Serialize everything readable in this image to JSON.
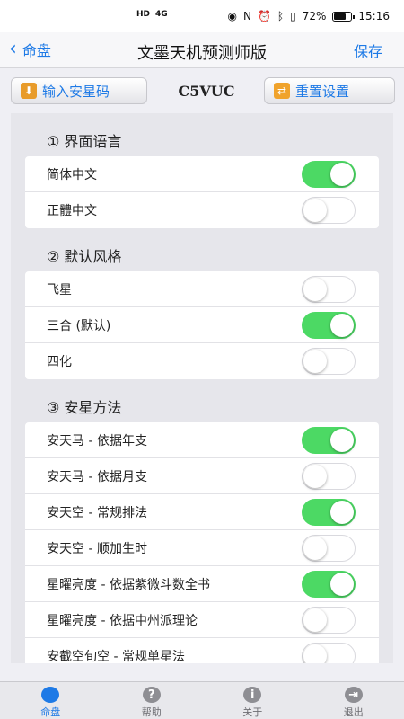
{
  "status": {
    "time": "15:16",
    "battery": "72%",
    "network": "4G"
  },
  "nav": {
    "back_label": "命盘",
    "title": "文墨天机预测师版",
    "save_label": "保存"
  },
  "toolbar": {
    "import_label": "输入安星码",
    "code": "C5VUC",
    "reset_label": "重置设置"
  },
  "sections": [
    {
      "title": "① 界面语言",
      "rows": [
        {
          "label": "简体中文",
          "on": true
        },
        {
          "label": "正體中文",
          "on": false
        }
      ]
    },
    {
      "title": "② 默认风格",
      "rows": [
        {
          "label": "飞星",
          "on": false
        },
        {
          "label": "三合 (默认)",
          "on": true
        },
        {
          "label": "四化",
          "on": false
        }
      ]
    },
    {
      "title": "③ 安星方法",
      "rows": [
        {
          "label": "安天马 - 依据年支",
          "on": true
        },
        {
          "label": "安天马 - 依据月支",
          "on": false
        },
        {
          "label": "安天空 - 常规排法",
          "on": true
        },
        {
          "label": "安天空 - 顺加生时",
          "on": false
        },
        {
          "label": "星曜亮度 - 依据紫微斗数全书",
          "on": true
        },
        {
          "label": "星曜亮度 - 依据中州派理论",
          "on": false
        },
        {
          "label": "安截空旬空 - 常规单星法",
          "on": false
        }
      ]
    }
  ],
  "tabs": [
    {
      "label": "命盘",
      "icon": "disc-icon",
      "active": true
    },
    {
      "label": "帮助",
      "icon": "help-icon",
      "active": false
    },
    {
      "label": "关于",
      "icon": "info-icon",
      "active": false
    },
    {
      "label": "退出",
      "icon": "exit-icon",
      "active": false
    }
  ],
  "colors": {
    "accent": "#1e7ae6",
    "toggle_on": "#4cd964"
  }
}
